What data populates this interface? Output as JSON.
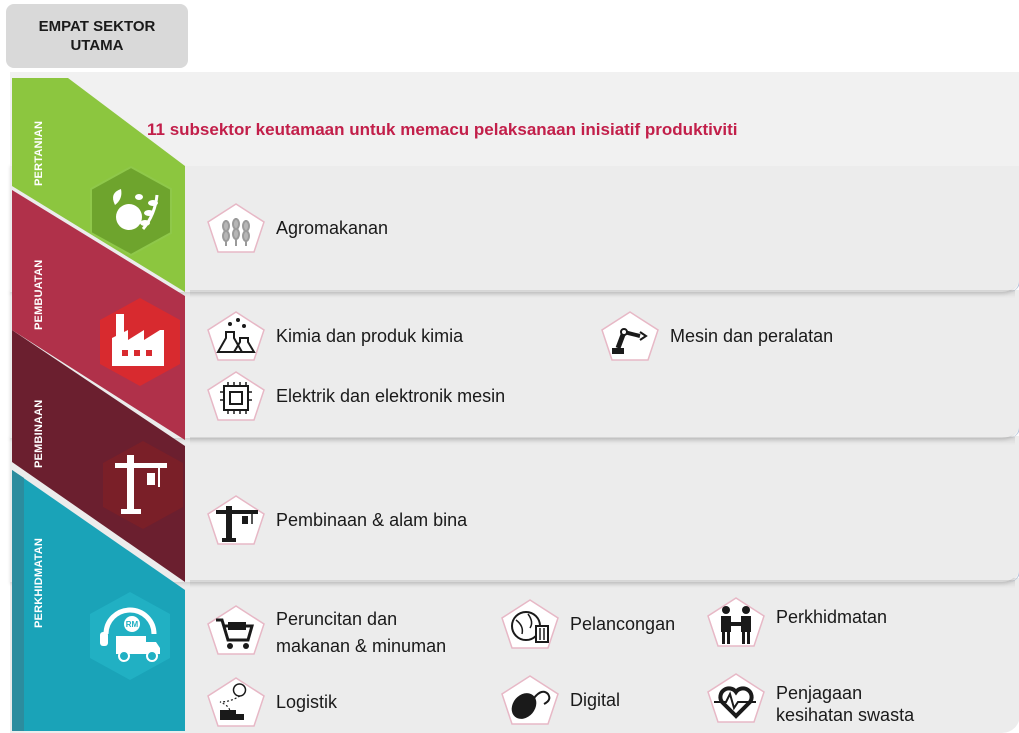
{
  "header": {
    "title_line1": "EMPAT SEKTOR",
    "title_line2": "UTAMA"
  },
  "subtitle": "11 subsektor keutamaan untuk memacu pelaksanaan inisiatif produktiviti",
  "sectors": [
    {
      "label": "PERTANIAN",
      "color": "#8cc63f",
      "icon": "leaf-fruit-icon",
      "items": [
        {
          "label": "Agromakanan",
          "icon": "wheat-icon"
        }
      ]
    },
    {
      "label": "PEMBUATAN",
      "color": "#b0314a",
      "icon": "factory-icon",
      "items": [
        {
          "label": "Kimia dan produk kimia",
          "icon": "flask-icon"
        },
        {
          "label": "Mesin dan peralatan",
          "icon": "robot-arm-icon"
        },
        {
          "label": "Elektrik dan elektronik mesin",
          "icon": "chip-icon"
        }
      ]
    },
    {
      "label": "PEMBINAAN",
      "color": "#6b1f2f",
      "icon": "crane-icon",
      "items": [
        {
          "label": "Pembinaan & alam bina",
          "icon": "tower-crane-icon"
        }
      ]
    },
    {
      "label": "PERKHIDMATAN",
      "color": "#1aa3b8",
      "icon": "delivery-truck-icon",
      "items": [
        {
          "label_line1": "Peruncitan dan",
          "label_line2": "makanan & minuman",
          "icon": "shopping-cart-icon"
        },
        {
          "label": "Pelancongan",
          "icon": "globe-luggage-icon"
        },
        {
          "label": "Perkhidmatan",
          "icon": "handshake-icon"
        },
        {
          "label": "Logistik",
          "icon": "route-icon"
        },
        {
          "label": "Digital",
          "icon": "mouse-icon"
        },
        {
          "label_line1": "Penjagaan",
          "label_line2": "kesihatan swasta",
          "icon": "heart-pulse-icon"
        }
      ]
    }
  ],
  "truck_badge": "RM"
}
